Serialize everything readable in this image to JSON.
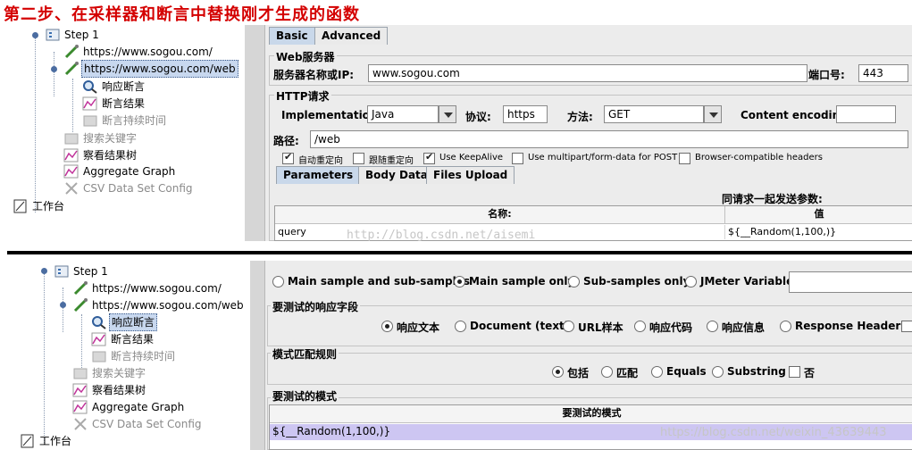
{
  "heading": "第二步、在采样器和断言中替换刚才生成的函数",
  "top": {
    "tree": {
      "items": [
        {
          "label": "Step 1",
          "icon": "thread-group-icon"
        },
        {
          "label": "https://www.sogou.com/",
          "icon": "pipette-icon"
        },
        {
          "label": "https://www.sogou.com/web",
          "icon": "pipette-icon"
        },
        {
          "label": "响应断言",
          "icon": "magnifier-icon"
        },
        {
          "label": "断言结果",
          "icon": "graph-icon"
        },
        {
          "label": "断言持续时间",
          "icon": "disabled-element-icon"
        },
        {
          "label": "搜索关键字",
          "icon": "disabled-element-icon"
        },
        {
          "label": "察看结果树",
          "icon": "graph-icon"
        },
        {
          "label": "Aggregate Graph",
          "icon": "graph-icon"
        },
        {
          "label": "CSV Data Set Config",
          "icon": "scissors-icon"
        },
        {
          "label": "工作台",
          "icon": "workbench-icon"
        }
      ]
    },
    "tabs": [
      "Basic",
      "Advanced"
    ],
    "web_server_title": "Web服务器",
    "server_label": "服务器名称或IP:",
    "server_value": "www.sogou.com",
    "port_label": "端口号:",
    "port_value": "443",
    "http_title": "HTTP请求",
    "impl_label": "Implementation:",
    "impl_value": "Java",
    "protocol_label": "协议:",
    "protocol_value": "https",
    "method_label": "方法:",
    "method_value": "GET",
    "encoding_label": "Content encoding:",
    "encoding_value": "",
    "path_label": "路径:",
    "path_value": "/web",
    "options": [
      {
        "label": "自动重定向",
        "checked": true
      },
      {
        "label": "跟随重定向",
        "checked": false
      },
      {
        "label": "Use KeepAlive",
        "checked": true
      },
      {
        "label": "Use multipart/form-data for POST",
        "checked": false
      },
      {
        "label": "Browser-compatible headers",
        "checked": false
      }
    ],
    "subtabs": [
      "Parameters",
      "Body Data",
      "Files Upload"
    ],
    "params_caption": "同请求一起发送参数:",
    "col_name": "名称:",
    "col_value": "值",
    "row_name": "query",
    "row_value": "${__Random(1,100,)}",
    "watermark": "http://blog.csdn.net/aisemi"
  },
  "bottom": {
    "tree": {
      "items": [
        {
          "label": "Step 1",
          "icon": "thread-group-icon"
        },
        {
          "label": "https://www.sogou.com/",
          "icon": "pipette-icon"
        },
        {
          "label": "https://www.sogou.com/web",
          "icon": "pipette-icon"
        },
        {
          "label": "响应断言",
          "icon": "magnifier-icon"
        },
        {
          "label": "断言结果",
          "icon": "graph-icon"
        },
        {
          "label": "断言持续时间",
          "icon": "disabled-element-icon"
        },
        {
          "label": "搜索关键字",
          "icon": "disabled-element-icon"
        },
        {
          "label": "察看结果树",
          "icon": "graph-icon"
        },
        {
          "label": "Aggregate Graph",
          "icon": "graph-icon"
        },
        {
          "label": "CSV Data Set Config",
          "icon": "scissors-icon"
        },
        {
          "label": "工作台",
          "icon": "workbench-icon"
        }
      ]
    },
    "apply_to": [
      {
        "label": "Main sample and sub-samples",
        "checked": false
      },
      {
        "label": "Main sample only",
        "checked": true
      },
      {
        "label": "Sub-samples only",
        "checked": false
      },
      {
        "label": "JMeter Variable",
        "checked": false
      }
    ],
    "field_title": "要测试的响应字段",
    "fields": [
      {
        "label": "响应文本",
        "checked": true
      },
      {
        "label": "Document (text)",
        "checked": false
      },
      {
        "label": "URL样本",
        "checked": false
      },
      {
        "label": "响应代码",
        "checked": false
      },
      {
        "label": "响应信息",
        "checked": false
      },
      {
        "label": "Response Headers",
        "checked": false
      }
    ],
    "rule_title": "模式匹配规则",
    "rules": [
      {
        "label": "包括",
        "checked": true
      },
      {
        "label": "匹配",
        "checked": false
      },
      {
        "label": "Equals",
        "checked": false
      },
      {
        "label": "Substring",
        "checked": false
      }
    ],
    "not_label": "否",
    "patterns_title": "要测试的模式",
    "patterns_header": "要测试的模式",
    "pattern_value": "${__Random(1,100,)}",
    "watermark": "https://blog.csdn.net/weixin_43639443"
  },
  "colors": {
    "heading": "#d40000",
    "selection": "#c8d8ef",
    "pattern_row": "#cdc6f2"
  }
}
